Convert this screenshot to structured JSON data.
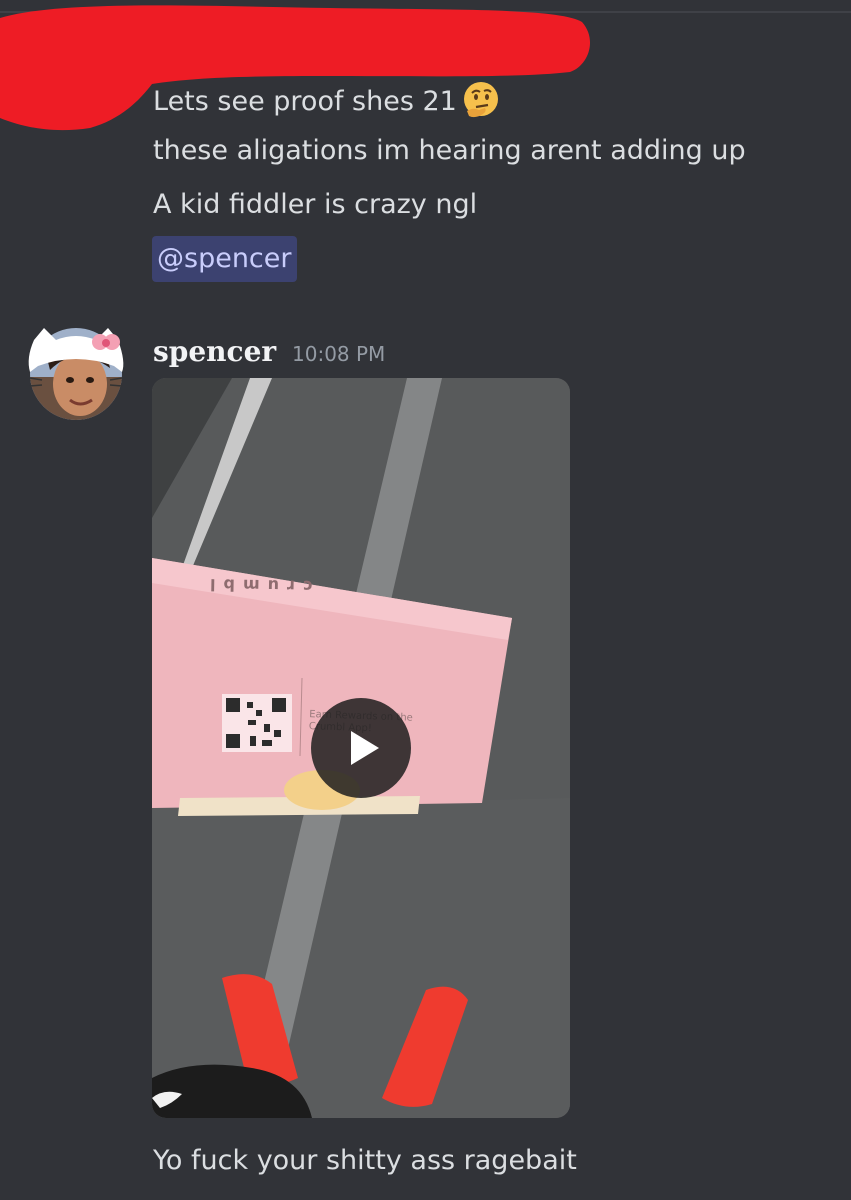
{
  "messages_above": {
    "lines": [
      "Lets see proof shes 21",
      "these aligations im hearing arent adding up",
      "A kid fiddler is crazy ngl"
    ],
    "emoji": "thinking-face-emoji",
    "mention": "@spencer"
  },
  "reply": {
    "username": "spencer",
    "timestamp": "10:08 PM",
    "video": {
      "brand": "crumbl",
      "box_text": "Earn Rewards on the Crumbl App!"
    },
    "message": "Yo fuck your shitty ass ragebait"
  },
  "colors": {
    "background": "#313338",
    "text": "#dbdee1",
    "mention_bg": "#3c4270",
    "mention_text": "#c9cdfb",
    "redaction": "#ee1c25",
    "timestamp": "#949ba4"
  }
}
